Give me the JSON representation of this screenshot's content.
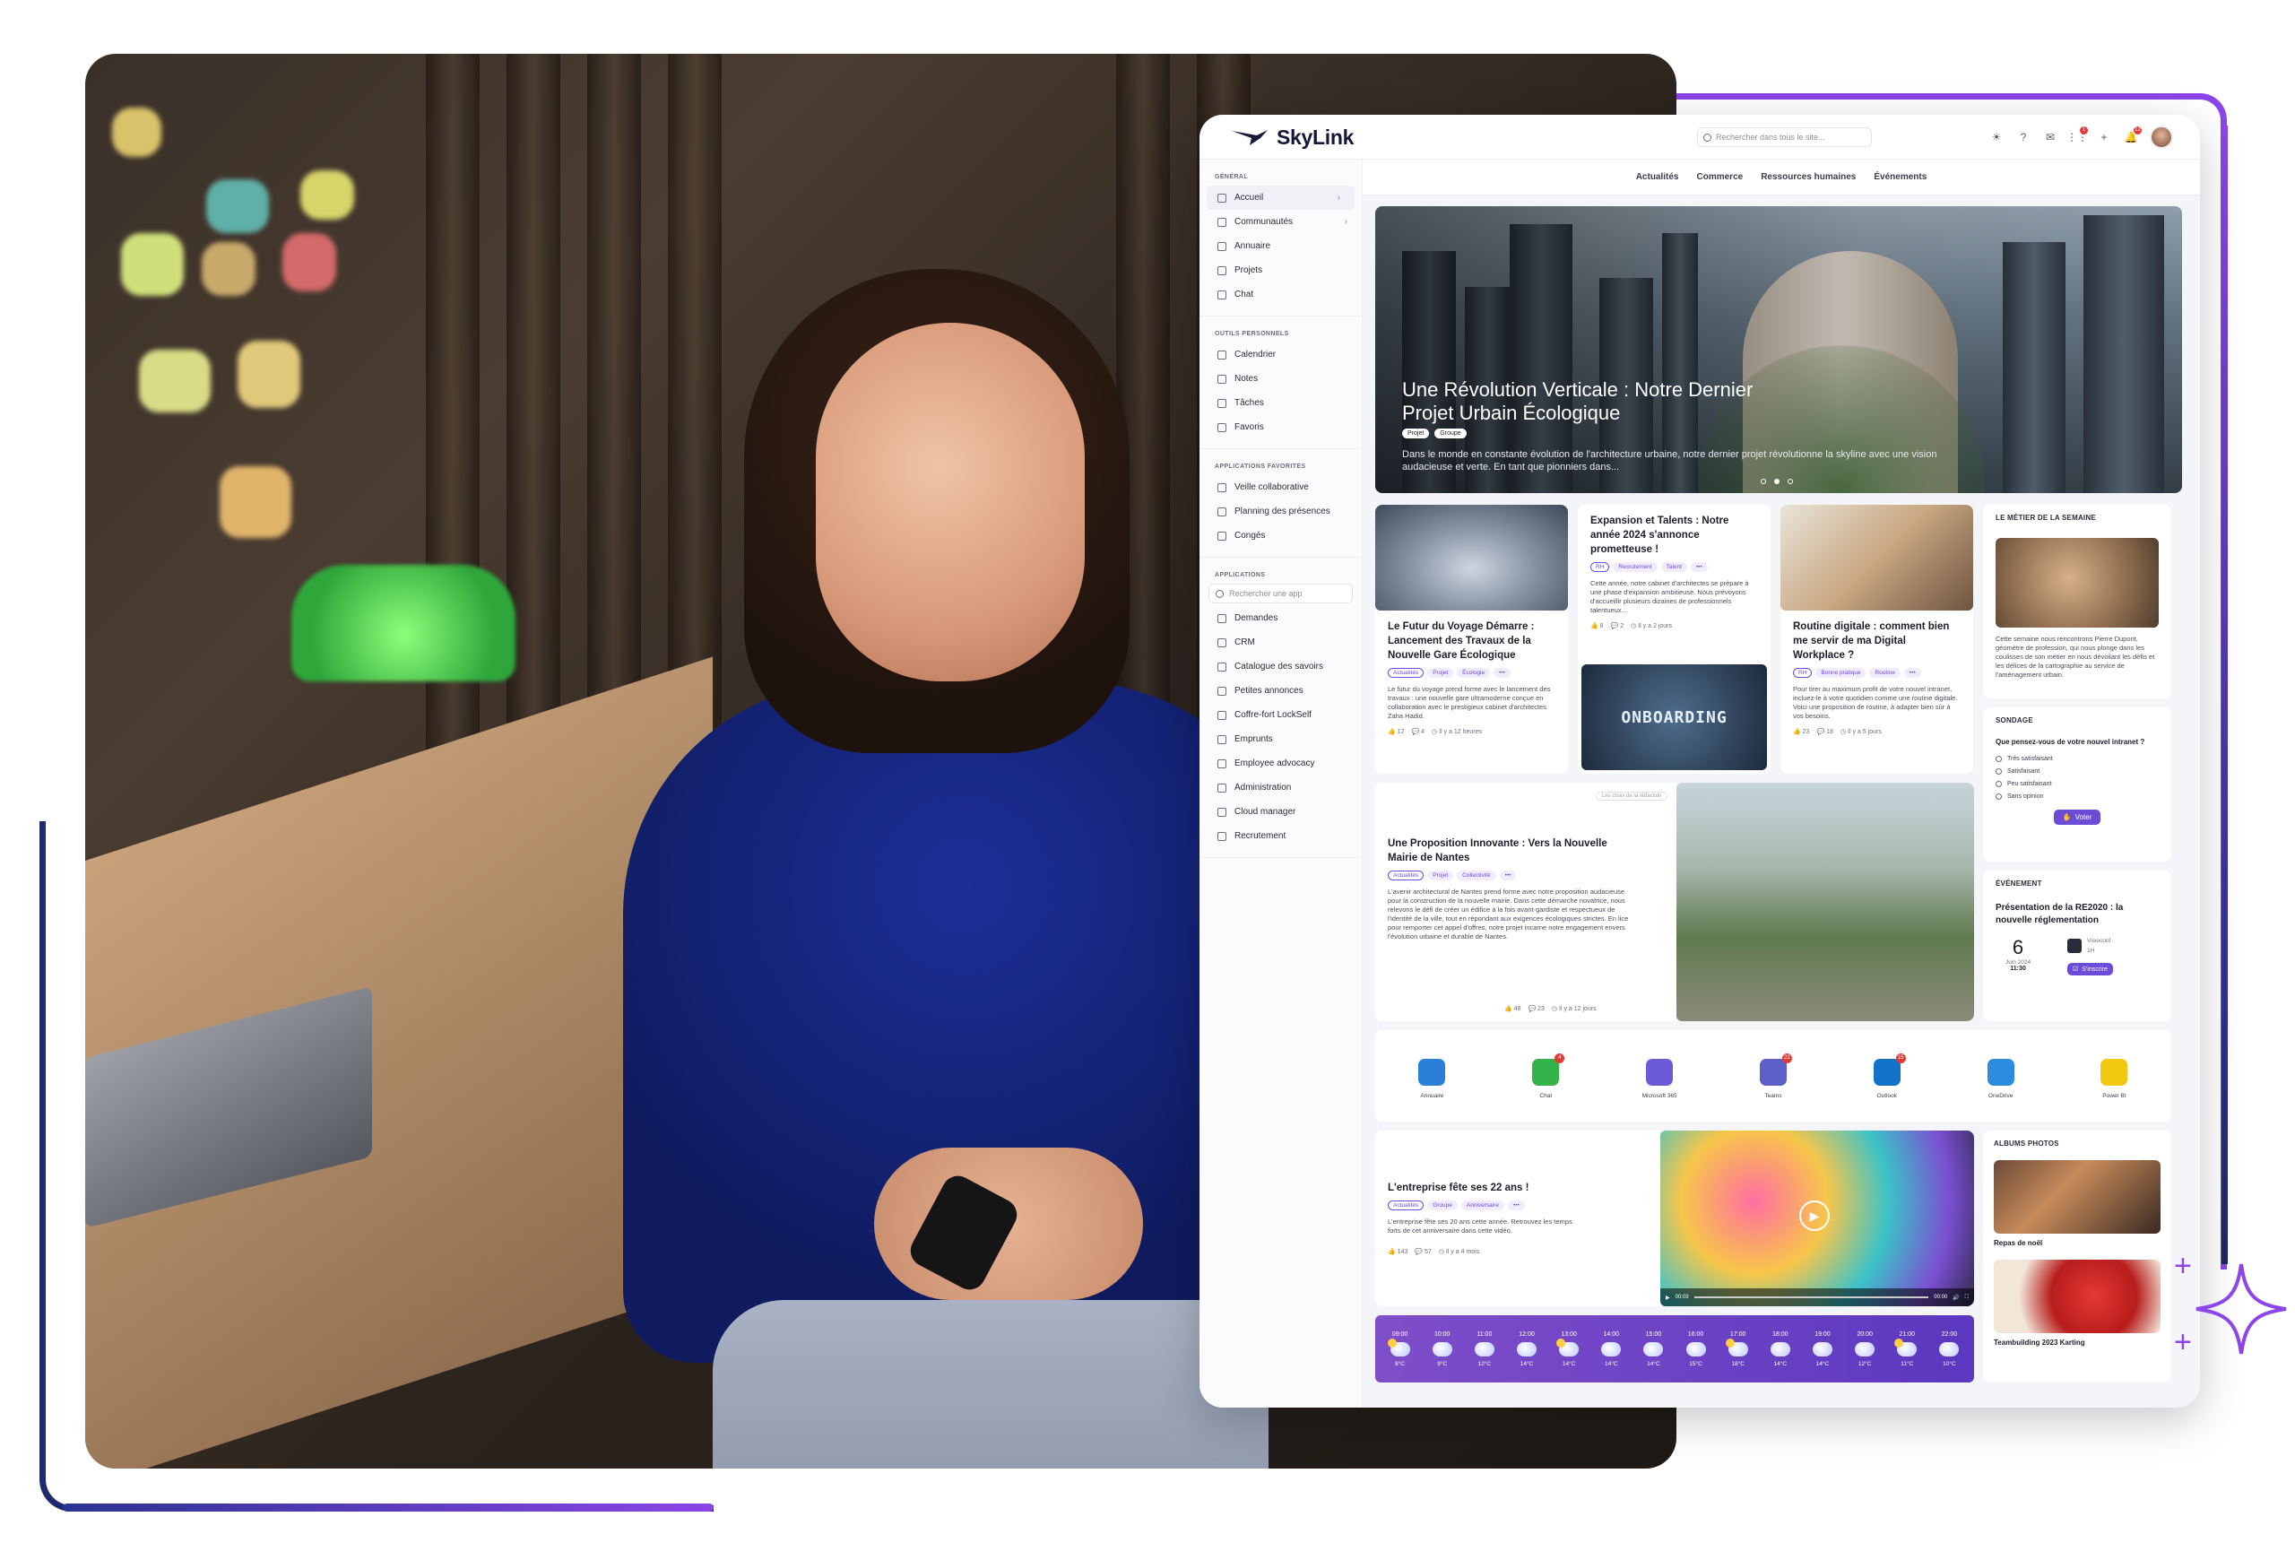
{
  "app": {
    "brand": "SkyLink",
    "search_placeholder": "Rechercher dans tous le site...",
    "notification_badges": {
      "apps": "1",
      "bell": "12"
    }
  },
  "sidebar": {
    "sections": [
      {
        "title": "GÉNÉRAL",
        "items": [
          {
            "label": "Accueil",
            "icon": "grid-icon",
            "chevron": true,
            "active": true
          },
          {
            "label": "Communautés",
            "icon": "people-icon",
            "chevron": true
          },
          {
            "label": "Annuaire",
            "icon": "person-icon"
          },
          {
            "label": "Projets",
            "icon": "list-icon"
          },
          {
            "label": "Chat",
            "icon": "chat-icon"
          }
        ]
      },
      {
        "title": "OUTILS PERSONNELS",
        "items": [
          {
            "label": "Calendrier",
            "icon": "calendar-icon"
          },
          {
            "label": "Notes",
            "icon": "note-icon"
          },
          {
            "label": "Tâches",
            "icon": "tasks-icon"
          },
          {
            "label": "Favoris",
            "icon": "star-icon"
          }
        ]
      },
      {
        "title": "APPLICATIONS FAVORITES",
        "items": [
          {
            "label": "Veille collaborative",
            "icon": "link-icon"
          },
          {
            "label": "Planning des présences",
            "icon": "calendar-check-icon"
          },
          {
            "label": "Congés",
            "icon": "umbrella-icon"
          }
        ]
      },
      {
        "title": "APPLICATIONS",
        "search_placeholder": "Rechercher une app",
        "items": [
          {
            "label": "Demandes",
            "icon": "inbox-icon"
          },
          {
            "label": "CRM",
            "icon": "crm-icon"
          },
          {
            "label": "Catalogue des savoirs",
            "icon": "book-icon"
          },
          {
            "label": "Petites annonces",
            "icon": "tag-icon"
          },
          {
            "label": "Coffre-fort LockSelf",
            "icon": "safe-icon"
          },
          {
            "label": "Emprunts",
            "icon": "refresh-icon"
          },
          {
            "label": "Employee advocacy",
            "icon": "megaphone-icon"
          },
          {
            "label": "Administration",
            "icon": "shield-icon"
          },
          {
            "label": "Cloud manager",
            "icon": "cloud-icon"
          },
          {
            "label": "Recrutement",
            "icon": "recruit-icon"
          }
        ]
      }
    ]
  },
  "subnav": [
    "Actualités",
    "Commerce",
    "Ressources humaines",
    "Événements"
  ],
  "hero": {
    "title": "Une Révolution Verticale : Notre Dernier Projet Urbain Écologique",
    "tags": [
      "Projet",
      "Groupe"
    ],
    "description": "Dans le monde en constante évolution de l'architecture urbaine, notre dernier projet révolutionne la skyline avec une vision audacieuse et verte. En tant que pionniers dans..."
  },
  "articles": [
    {
      "title": "Le Futur du Voyage Démarre : Lancement des Travaux de la Nouvelle Gare Écologique",
      "tags": [
        "Actualités",
        "Projet",
        "Écologie",
        "•••"
      ],
      "text": "Le futur du voyage prend forme avec le lancement des travaux : une nouvelle gare ultramoderne conçue en collaboration avec le prestigieux cabinet d'architectes Zaha Hadid.",
      "likes": "12",
      "comments": "4",
      "time": "Il y a 12 heures"
    },
    {
      "title": "Expansion et Talents : Notre année 2024 s'annonce prometteuse !",
      "tags": [
        "RH",
        "Recrutement",
        "Talent",
        "•••"
      ],
      "text": "Cette année, notre cabinet d'architectes se prépare à une phase d'expansion ambitieuse. Nous prévoyons d'accueillir plusieurs dizaines de professionnels talentueux...",
      "likes": "8",
      "comments": "2",
      "time": "Il y a 2 jours",
      "image_text": "ONBOARDING"
    },
    {
      "title": "Routine digitale : comment bien me servir de ma Digital Workplace ?",
      "tags": [
        "RH",
        "Bonne pratique",
        "Routine",
        "•••"
      ],
      "text": "Pour tirer au maximum profit de votre nouvel intranet, incluez-le à votre quotidien comme une routine digitale. Voici une proposition de routine, à adapter bien sûr à vos besoins.",
      "likes": "23",
      "comments": "18",
      "time": "Il y a 5 jours"
    },
    {
      "kicker": "Les choix de la rédaction",
      "title": "Une Proposition Innovante : Vers la Nouvelle Mairie de Nantes",
      "tags": [
        "Actualités",
        "Projet",
        "Collectivité",
        "•••"
      ],
      "text": "L'avenir architectural de Nantes prend forme avec notre proposition audacieuse pour la construction de la nouvelle mairie. Dans cette démarche novatrice, nous relevons le défi de créer un édifice à la fois avant-gardiste et respectueux de l'identité de la ville, tout en répondant aux exigences écologiques strictes. En lice pour remporter cet appel d'offres, notre projet incarne notre engagement envers l'évolution urbaine et durable de Nantes.",
      "likes": "48",
      "comments": "23",
      "time": "Il y a 12 jours"
    },
    {
      "title": "L'entreprise fête ses 22 ans !",
      "tags": [
        "Actualités",
        "Groupe",
        "Anniversaire",
        "•••"
      ],
      "text": "L'entreprise fête ses 20 ans cette année. Retrouvez les temps forts de cet anniversaire dans cette vidéo.",
      "likes": "143",
      "comments": "57",
      "time": "Il y a 4 mois",
      "video_time": "00:03",
      "video_end": "00:00"
    }
  ],
  "job_of_week": {
    "label": "LE MÉTIER DE LA SEMAINE",
    "text": "Cette semaine nous rencontrons Pierre Dupont, géomètre de profession, qui nous plonge dans les coulisses de son métier en nous dévoilant les défis et les délices de la cartographie au service de l'aménagement urbain."
  },
  "poll": {
    "label": "SONDAGE",
    "question": "Que pensez-vous de votre nouvel intranet ?",
    "options": [
      "Très satisfaisant",
      "Satisfaisant",
      "Peu satisfaisant",
      "Sans opinion"
    ],
    "button": "Voter"
  },
  "event": {
    "label": "ÉVÉNEMENT",
    "title": "Présentation de la RE2020 : la nouvelle réglementation",
    "day": "6",
    "month": "Juin 2024",
    "hour": "11:30",
    "mode": "Visioconf.",
    "duration": "1H",
    "button": "S'inscrire"
  },
  "apps": [
    {
      "label": "Annuaire",
      "color": "#2b7fd6",
      "badge": ""
    },
    {
      "label": "Chat",
      "color": "#35b24a",
      "badge": "4"
    },
    {
      "label": "Microsoft 365",
      "color": "#6b5bd6",
      "badge": ""
    },
    {
      "label": "Teams",
      "color": "#5b5fc7",
      "badge": "22"
    },
    {
      "label": "Outlook",
      "color": "#1572c9",
      "badge": "15"
    },
    {
      "label": "OneDrive",
      "color": "#2c8de0",
      "badge": ""
    },
    {
      "label": "Power BI",
      "color": "#f2c811",
      "badge": ""
    }
  ],
  "albums": {
    "label": "ALBUMS PHOTOS",
    "items": [
      {
        "label": "Repas de noël"
      },
      {
        "label": "Teambuilding 2023 Karting"
      }
    ]
  },
  "weather": [
    {
      "time": "09:00",
      "temp": "8°C",
      "sun": true
    },
    {
      "time": "10:00",
      "temp": "9°C",
      "sun": false
    },
    {
      "time": "11:00",
      "temp": "12°C",
      "sun": false
    },
    {
      "time": "12:00",
      "temp": "14°C",
      "sun": false
    },
    {
      "time": "13:00",
      "temp": "14°C",
      "sun": true
    },
    {
      "time": "14:00",
      "temp": "14°C",
      "sun": false
    },
    {
      "time": "15:00",
      "temp": "14°C",
      "sun": false
    },
    {
      "time": "16:00",
      "temp": "15°C",
      "sun": false
    },
    {
      "time": "17:00",
      "temp": "18°C",
      "sun": true
    },
    {
      "time": "18:00",
      "temp": "14°C",
      "sun": false
    },
    {
      "time": "19:00",
      "temp": "14°C",
      "sun": false
    },
    {
      "time": "20:00",
      "temp": "12°C",
      "sun": false
    },
    {
      "time": "21:00",
      "temp": "11°C",
      "sun": true
    },
    {
      "time": "22:00",
      "temp": "10°C",
      "sun": false
    }
  ],
  "colors": {
    "accent": "#6c4cd6",
    "frame_purple": "#8b45e8",
    "frame_navy": "#1e2a6b"
  }
}
